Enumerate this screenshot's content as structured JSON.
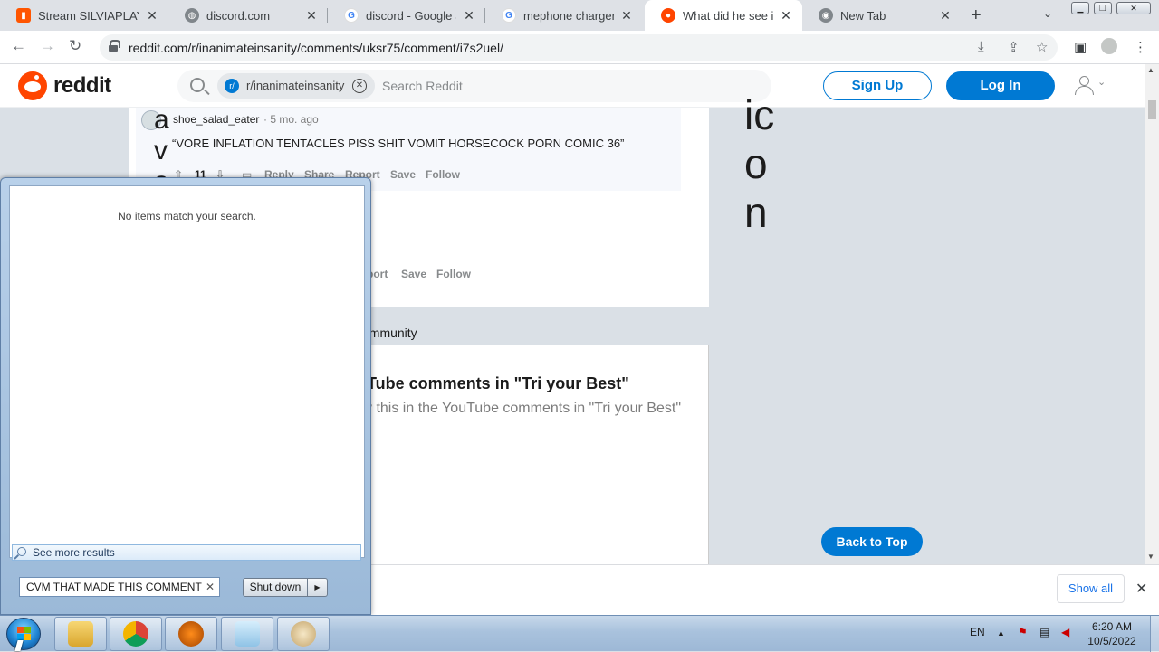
{
  "browser": {
    "tabs": [
      {
        "title": "Stream SILVIAPLAYA",
        "favicon": "soundcloud-icon",
        "color": "#ff5500"
      },
      {
        "title": "discord.com",
        "favicon": "globe-icon",
        "color": "#5f6368"
      },
      {
        "title": "discord - Google Sea",
        "favicon": "google-icon",
        "color": "#4285f4"
      },
      {
        "title": "mephone charger - G",
        "favicon": "google-icon",
        "color": "#4285f4"
      },
      {
        "title": "What did he see in th",
        "favicon": "reddit-icon",
        "color": "#ff4500",
        "active": true
      },
      {
        "title": "New Tab",
        "favicon": "chrome-icon",
        "color": "#5f6368"
      }
    ],
    "url": "reddit.com/r/inanimateinsanity/comments/uksr75/comment/i7s2uel/"
  },
  "reddit": {
    "wordmark": "reddit",
    "search_chip": "r/inanimateinsanity",
    "search_chip_icon": "r/",
    "search_placeholder": "Search Reddit",
    "signup": "Sign Up",
    "login": "Log In"
  },
  "comment": {
    "author": "shoe_salad_eater",
    "meta": "· 5 mo. ago",
    "body": "“VORE INFLATION TENTACLES PISS SHIT VOMIT HORSECOCK PORN COMIC 36”",
    "votes": "11",
    "actions": [
      "Reply",
      "Share",
      "Report",
      "Save",
      "Follow"
    ],
    "glyph": "a v a t"
  },
  "parent_actions": [
    "port",
    "Save",
    "Follow"
  ],
  "side_glyph": "ic o n",
  "section_label": "ommunity",
  "card": {
    "title": "Tube comments in \"Tri your Best\"",
    "body": "v this in the YouTube comments in \"Tri your Best\""
  },
  "back_to_top": "Back to Top",
  "download_bar": {
    "show_all": "Show all"
  },
  "start_menu": {
    "no_items": "No items match your search.",
    "see_more": "See more results",
    "search_value": "CVM THAT MADE THIS COMMENT",
    "shutdown": "Shut down"
  },
  "taskbar": {
    "apps": [
      "explorer-icon",
      "chrome-icon",
      "fl-studio-icon",
      "notepad-icon",
      "paint-icon"
    ],
    "lang": "EN",
    "time": "6:20 AM",
    "date": "10/5/2022"
  }
}
